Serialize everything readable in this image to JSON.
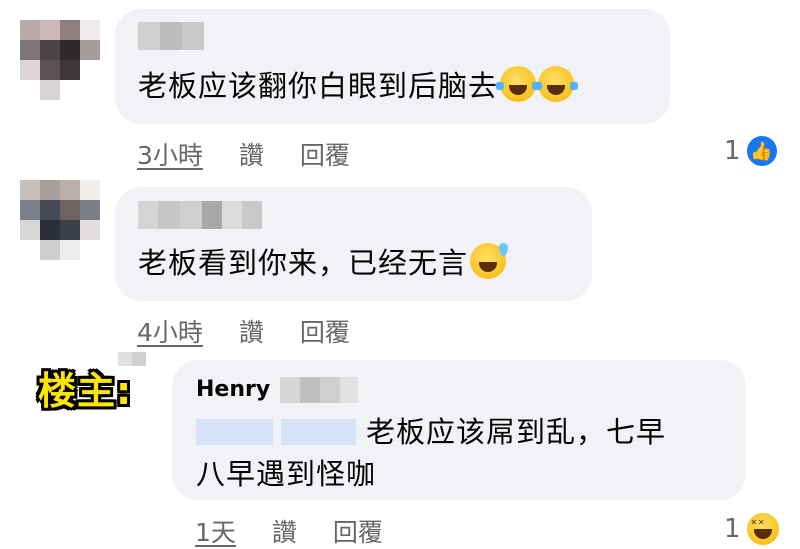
{
  "comments": [
    {
      "text": "老板应该翻你白眼到后脑去",
      "emojis": [
        "rolling-on-floor-laughing",
        "rolling-on-floor-laughing"
      ],
      "time": "3小時",
      "like_label": "讚",
      "reply_label": "回覆",
      "reaction_count": "1",
      "reaction_type": "like"
    },
    {
      "text": "老板看到你来，已经无言",
      "emojis": [
        "grinning-sweat"
      ],
      "time": "4小時",
      "like_label": "讚",
      "reply_label": "回覆"
    }
  ],
  "reply": {
    "owner_label": "楼主:",
    "author": "Henry",
    "text_line1": "老板应该屌到乱，七早",
    "text_line2": "八早遇到怪咖",
    "time": "1天",
    "like_label": "讚",
    "reply_label": "回覆",
    "reaction_count": "1",
    "reaction_type": "haha"
  },
  "colors": {
    "bubble": "#f0f2f5",
    "meta_text": "#65676b",
    "like_blue": "#1877f2",
    "owner_yellow": "#ffe600"
  }
}
